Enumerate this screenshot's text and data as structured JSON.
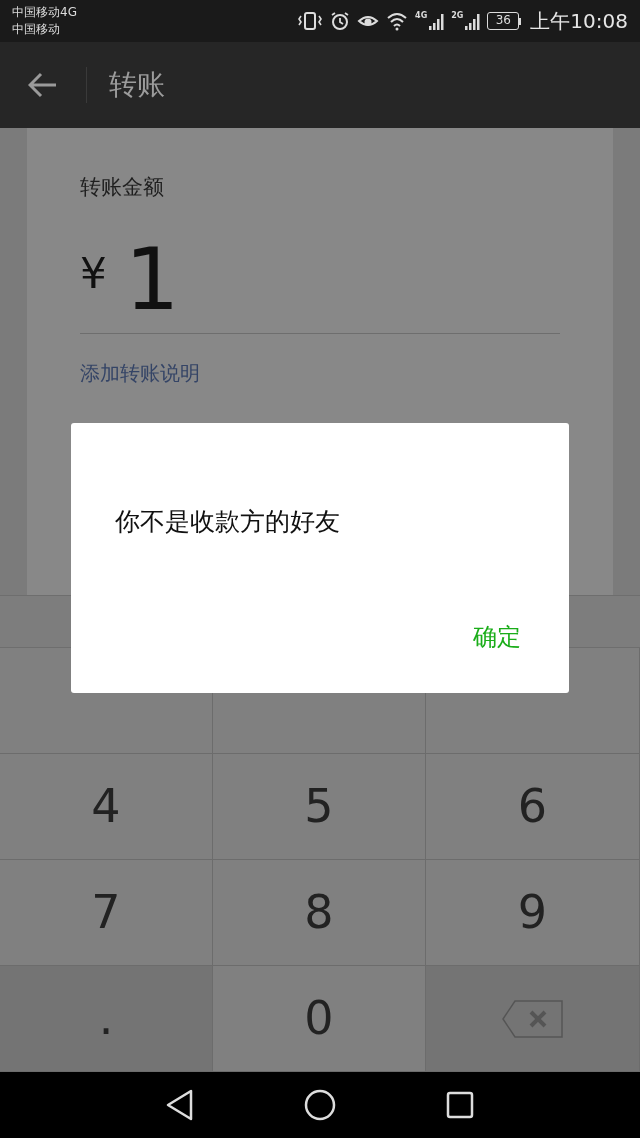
{
  "status_bar": {
    "carriers": [
      "中国移动4G",
      "中国移动"
    ],
    "network_labels": [
      "4G",
      "2G"
    ],
    "battery": "36",
    "time": "上午10:08"
  },
  "header": {
    "title": "转账"
  },
  "form": {
    "label": "转账金额",
    "currency": "¥",
    "amount": "1",
    "note_link": "添加转账说明"
  },
  "keypad": {
    "keys": [
      {
        "kind": "covered"
      },
      {
        "kind": "covered"
      },
      {
        "kind": "covered"
      },
      {
        "kind": "digit",
        "label": "4"
      },
      {
        "kind": "digit",
        "label": "5"
      },
      {
        "kind": "digit",
        "label": "6"
      },
      {
        "kind": "digit",
        "label": "7"
      },
      {
        "kind": "digit",
        "label": "8"
      },
      {
        "kind": "digit",
        "label": "9"
      },
      {
        "kind": "dot",
        "label": "."
      },
      {
        "kind": "digit",
        "label": "0"
      },
      {
        "kind": "backspace"
      }
    ]
  },
  "dialog": {
    "message": "你不是收款方的好友",
    "button": "确定"
  }
}
